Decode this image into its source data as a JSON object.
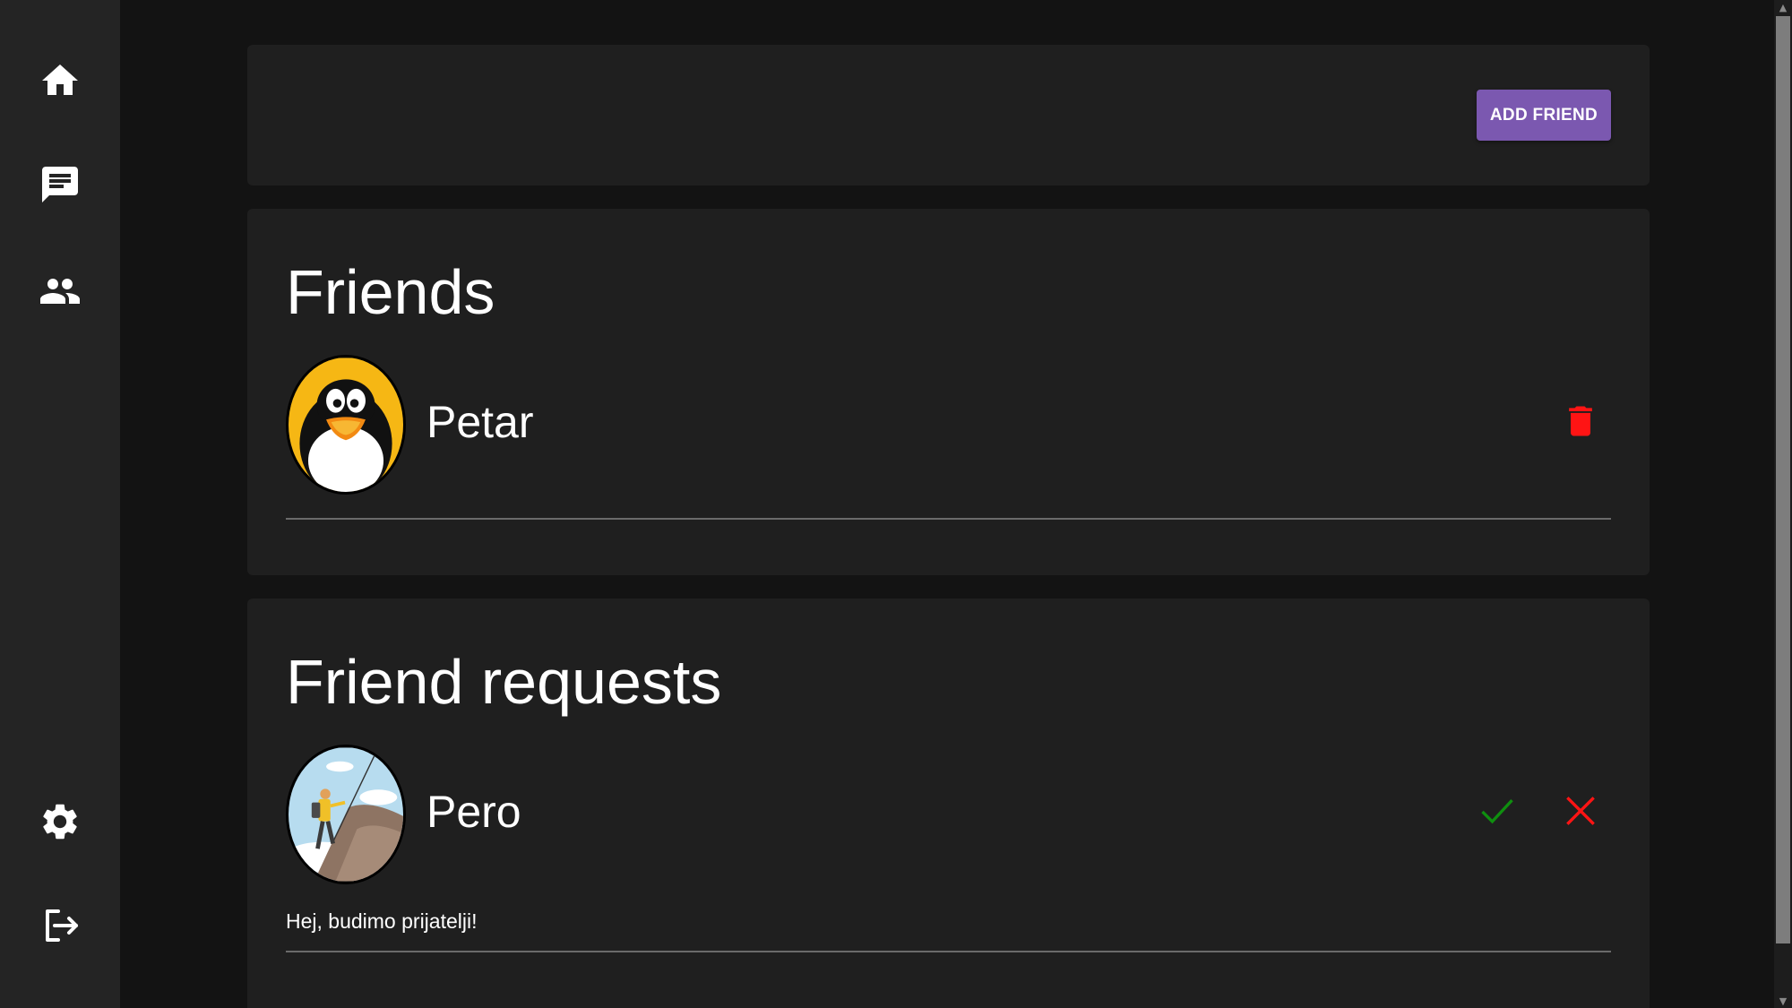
{
  "sidebar": {
    "items": [
      {
        "icon": "home-icon"
      },
      {
        "icon": "chat-icon"
      },
      {
        "icon": "people-icon"
      }
    ],
    "bottom_items": [
      {
        "icon": "gear-icon"
      },
      {
        "icon": "logout-icon"
      }
    ]
  },
  "toolbar": {
    "add_friend_label": "ADD FRIEND"
  },
  "friends": {
    "title": "Friends",
    "items": [
      {
        "name": "Petar",
        "avatar": "penguin-avatar",
        "action_icon": "trash-icon"
      }
    ]
  },
  "requests": {
    "title": "Friend requests",
    "items": [
      {
        "name": "Pero",
        "avatar": "climber-avatar",
        "message": "Hej, budimo prijatelji!",
        "accept_icon": "check-icon",
        "decline_icon": "close-icon"
      }
    ]
  },
  "colors": {
    "background": "#131313",
    "sidebar": "#242424",
    "card": "#1f1f1f",
    "accent": "#7b58b0",
    "delete": "#ff1414",
    "accept": "#0f8f0f",
    "decline": "#ff1414"
  }
}
